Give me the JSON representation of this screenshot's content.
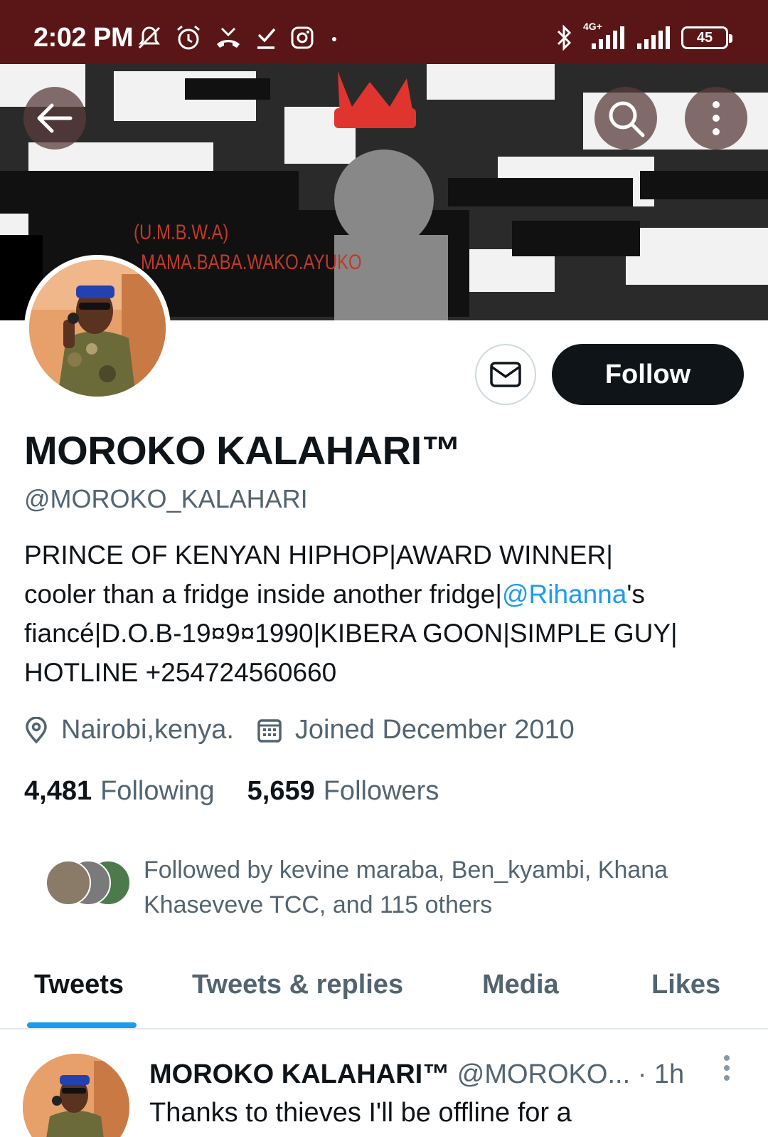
{
  "status_bar": {
    "time": "2:02 PM",
    "network": "4G+",
    "battery": "45",
    "icons_left": [
      "mute-icon",
      "alarm-icon",
      "missed-call-icon",
      "download-icon",
      "instagram-icon",
      "dot-icon"
    ],
    "icons_right": [
      "bluetooth-icon",
      "signal-icon",
      "signal-icon",
      "battery-icon"
    ]
  },
  "banner": {
    "line1": "(U.M.B.W.A)",
    "line2": "MAMA.BABA.WAKO.AYUKO"
  },
  "header_actions": {
    "back_icon": "back-arrow-icon",
    "search_icon": "search-icon",
    "more_icon": "more-vertical-icon"
  },
  "profile": {
    "display_name": "MOROKO KALAHARI™",
    "handle": "@MOROKO_KALAHARI",
    "bio_line1": "PRINCE OF KENYAN HIPHOP|AWARD WINNER|",
    "bio_line2_pre": "cooler than a fridge inside another fridge|",
    "bio_mention": "@Rihanna",
    "bio_line2_post": "'s",
    "bio_line3": "fiancé|D.O.B-19¤9¤1990|KIBERA GOON|SIMPLE GUY|",
    "bio_line4": "HOTLINE +254724560660",
    "location": "Nairobi,kenya.",
    "joined": "Joined December 2010",
    "following_count": "4,481",
    "following_label": "Following",
    "followers_count": "5,659",
    "followers_label": "Followers",
    "followed_by_line1": "Followed by kevine maraba, Ben_kyambi, Khana",
    "followed_by_line2": "Khaseveve TCC, and 115 others"
  },
  "buttons": {
    "follow": "Follow",
    "message_icon": "mail-icon"
  },
  "tabs": [
    "Tweets",
    "Tweets & replies",
    "Media",
    "Likes"
  ],
  "active_tab": "Tweets",
  "tweet": {
    "name": "MOROKO KALAHARI™",
    "handle": "@MOROKO...",
    "separator": "·",
    "time": "1h",
    "text": "Thanks to thieves I'll be offline for a"
  },
  "colors": {
    "status_bar": "#5a1616",
    "accent": "#1d9bf0",
    "follow_button": "#0f1419",
    "secondary_text": "#536471"
  }
}
